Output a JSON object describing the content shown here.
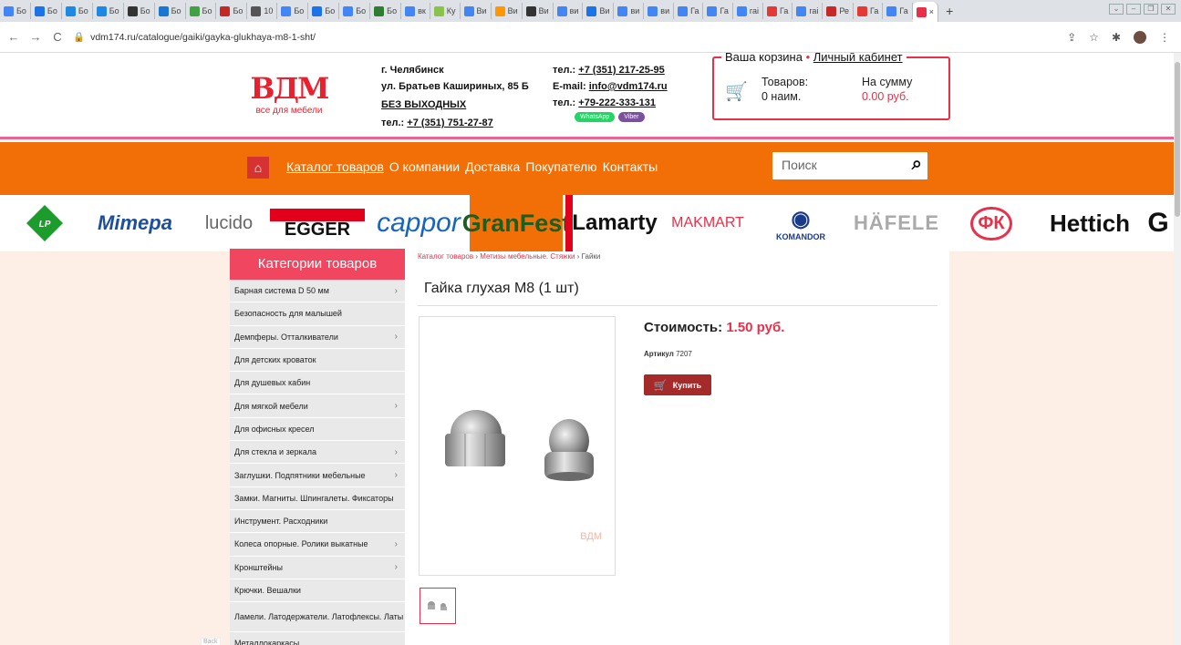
{
  "browser": {
    "tabs": [
      {
        "label": "Бо",
        "icon": "google-icon",
        "color": "#4285f4"
      },
      {
        "label": "Бо",
        "icon": "power-icon",
        "color": "#1a73e8"
      },
      {
        "label": "Бо",
        "icon": "site-icon",
        "color": "#1e88e5"
      },
      {
        "label": "Бо",
        "icon": "site-icon",
        "color": "#1e88e5"
      },
      {
        "label": "Бо",
        "icon": "site-icon",
        "color": "#333333"
      },
      {
        "label": "Бо",
        "icon": "site-icon",
        "color": "#1976d2"
      },
      {
        "label": "Бо",
        "icon": "site-icon",
        "color": "#43a047"
      },
      {
        "label": "Бо",
        "icon": "site-icon",
        "color": "#c62828"
      },
      {
        "label": "10",
        "icon": "site-icon",
        "color": "#555555"
      },
      {
        "label": "Бо",
        "icon": "google-icon",
        "color": "#4285f4"
      },
      {
        "label": "Бо",
        "icon": "power-icon",
        "color": "#1a73e8"
      },
      {
        "label": "Бо",
        "icon": "google-icon",
        "color": "#4285f4"
      },
      {
        "label": "Бо",
        "icon": "site-icon",
        "color": "#2e7d32"
      },
      {
        "label": "вк",
        "icon": "google-icon",
        "color": "#4285f4"
      },
      {
        "label": "Ку",
        "icon": "site-icon",
        "color": "#8bc34a"
      },
      {
        "label": "Ви",
        "icon": "google-icon",
        "color": "#4285f4"
      },
      {
        "label": "Ви",
        "icon": "site-icon",
        "color": "#ff9800"
      },
      {
        "label": "Ви",
        "icon": "site-icon",
        "color": "#333333"
      },
      {
        "label": "ви",
        "icon": "google-icon",
        "color": "#4285f4"
      },
      {
        "label": "Ви",
        "icon": "power-icon",
        "color": "#1a73e8"
      },
      {
        "label": "ви",
        "icon": "google-icon",
        "color": "#4285f4"
      },
      {
        "label": "ви",
        "icon": "google-icon",
        "color": "#4285f4"
      },
      {
        "label": "Га",
        "icon": "google-icon",
        "color": "#4285f4"
      },
      {
        "label": "Га",
        "icon": "google-icon",
        "color": "#4285f4"
      },
      {
        "label": "гаі",
        "icon": "google-icon",
        "color": "#4285f4"
      },
      {
        "label": "Га",
        "icon": "site-icon",
        "color": "#e53935"
      },
      {
        "label": "гаі",
        "icon": "google-icon",
        "color": "#4285f4"
      },
      {
        "label": "Ре",
        "icon": "site-icon",
        "color": "#c62828"
      },
      {
        "label": "Га",
        "icon": "site-icon",
        "color": "#e53935"
      },
      {
        "label": "Га",
        "icon": "google-icon",
        "color": "#4285f4"
      }
    ],
    "active_tab": {
      "label": "",
      "close": "×"
    },
    "new_tab": "+",
    "url": "vdm174.ru/catalogue/gaiki/gayka-glukhaya-m8-1-sht/"
  },
  "header": {
    "logo_mark": "ВДМ",
    "logo_tagline": "все для мебели",
    "city": "г. Челябинск",
    "street": "ул. Братьев Кашириных, 85 Б",
    "schedule": "БЕЗ ВЫХОДНЫХ",
    "phone2_label": "тел.: ",
    "phone2": "+7 (351) 751-27-87",
    "phone1_label": "тел.: ",
    "phone1": "+7 (351) 217-25-95",
    "email_label": "E-mail: ",
    "email": "info@vdm174.ru",
    "phone3_label": "тел.: ",
    "phone3": "+79-222-333-131",
    "whatsapp": "WhatsApp",
    "viber": "Viber"
  },
  "cart": {
    "title": "Ваша корзина",
    "separator": "•",
    "account": "Личный кабинет",
    "goods_label": "Товаров:",
    "goods_value": "0 наим.",
    "sum_label": "На сумму",
    "sum_value": "0.00 руб."
  },
  "nav": {
    "items": [
      "Каталог товаров",
      "О компании",
      "Доставка",
      "Покупателю",
      "Контакты"
    ],
    "search_placeholder": "Поиск"
  },
  "brands": [
    "LP",
    "Mimepa",
    "lucido",
    "EGGER",
    "cappor",
    "GranFest",
    "Lamarty",
    "MAKMART",
    "KOMANDOR",
    "HÄFELE",
    "ФК",
    "Hettich",
    "G"
  ],
  "sidebar": {
    "title": "Категории товаров",
    "items": [
      {
        "label": "Барная система D 50 мм",
        "arrow": true
      },
      {
        "label": "Безопасность для малышей",
        "arrow": false
      },
      {
        "label": "Демпферы. Отталкиватели",
        "arrow": true
      },
      {
        "label": "Для детских кроваток",
        "arrow": false
      },
      {
        "label": "Для душевых кабин",
        "arrow": false
      },
      {
        "label": "Для мягкой мебели",
        "arrow": true
      },
      {
        "label": "Для офисных кресел",
        "arrow": false
      },
      {
        "label": "Для стекла и зеркала",
        "arrow": true
      },
      {
        "label": "Заглушки. Подпятники мебельные",
        "arrow": true
      },
      {
        "label": "Замки. Магниты. Шпингалеты. Фиксаторы",
        "arrow": false
      },
      {
        "label": "Инструмент. Расходники",
        "arrow": false
      },
      {
        "label": "Колеса опорные. Ролики выкатные",
        "arrow": true
      },
      {
        "label": "Кронштейны",
        "arrow": true
      },
      {
        "label": "Крючки. Вешалки",
        "arrow": false
      },
      {
        "label": "Ламели. Латодержатели. Латофлексы. Латы",
        "arrow": false
      },
      {
        "label": "Металлокаркасы",
        "arrow": false
      }
    ],
    "back_tag": "Back"
  },
  "product": {
    "breadcrumbs": [
      "Каталог товаров",
      "Метизы мебельные. Стяжки",
      "Гайки"
    ],
    "crumb_sep": "›",
    "title": "Гайка глухая М8 (1 шт)",
    "price_label": "Стоимость: ",
    "price_value": "1.50 руб.",
    "sku_label": "Артикул",
    "sku_value": "7207",
    "buy_label": "Купить",
    "watermark": "ВДМ"
  }
}
